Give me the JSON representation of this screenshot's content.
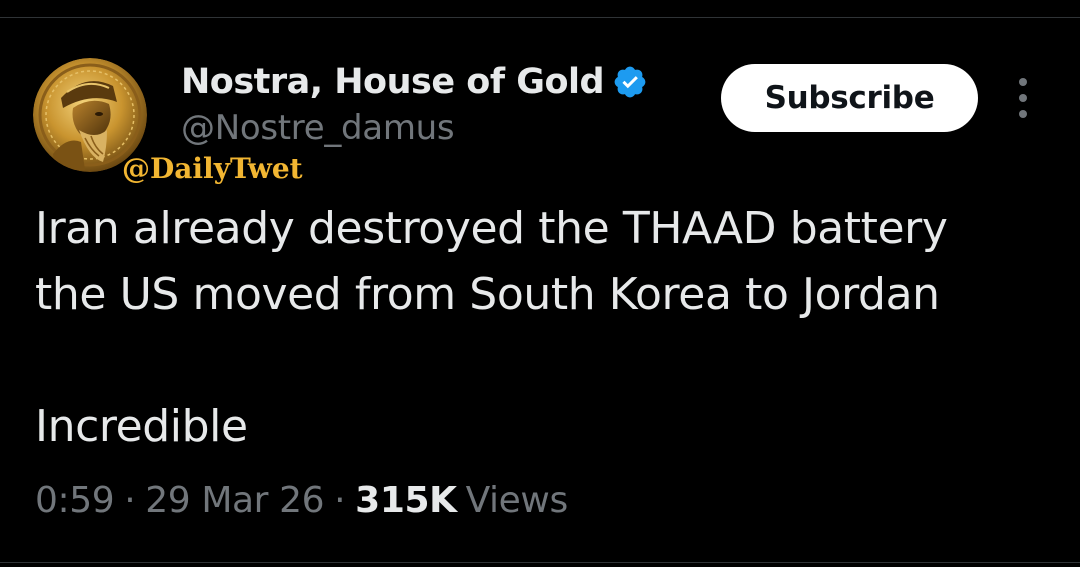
{
  "tweet": {
    "author": {
      "display_name": "Nostra, House of Gold",
      "handle": "@Nostre_damus",
      "verified": true,
      "avatar_icon": "golden-coin-bearded-man-avatar"
    },
    "subscribe_label": "Subscribe",
    "more_icon": "more-vertical-icon",
    "text_lines": [
      "Iran already destroyed the THAAD battery",
      "the US moved from South Korea to Jordan",
      "",
      "Incredible"
    ],
    "meta": {
      "time": "0:59",
      "separator": "·",
      "date": "29 Mar 26",
      "views_count": "315K",
      "views_label": "Views"
    }
  },
  "watermark": "@DailyTwet",
  "colors": {
    "background": "#000000",
    "primary_text": "#e7e9ea",
    "secondary_text": "#71767b",
    "verified_blue": "#1d9bf0",
    "watermark_gold": "#f2b632",
    "button_bg": "#ffffff",
    "button_text": "#0f1419"
  }
}
